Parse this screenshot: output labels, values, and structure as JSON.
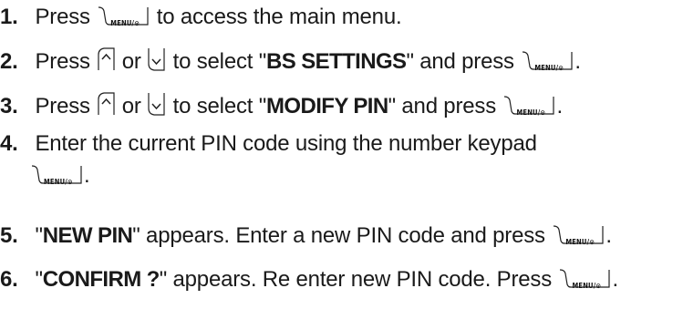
{
  "steps": [
    {
      "number": "1.",
      "text_a": " Press ",
      "text_b": " to access the main menu."
    },
    {
      "number": "2.",
      "text_a": " Press ",
      "text_or": " or ",
      "text_b": " to select \"",
      "keyword": "BS SETTINGS",
      "text_c": "\" and press ",
      "text_end": "."
    },
    {
      "number": "3.",
      "text_a": " Press ",
      "text_or": " or ",
      "text_b": " to select \"",
      "keyword": "MODIFY PIN",
      "text_c": "\" and press ",
      "text_end": "."
    },
    {
      "number": "4.",
      "text_a": " Enter the current PIN code using the number keypad",
      "text_end": "."
    },
    {
      "number": "5.",
      "text_a": " \"",
      "keyword": "NEW PIN",
      "text_b": "\" appears. Enter a new PIN code and press ",
      "text_end": "."
    },
    {
      "number": "6.",
      "text_a": " \"",
      "keyword": "CONFIRM ?",
      "text_b": "\" appears. Re enter new PIN code. Press ",
      "text_end": "."
    }
  ],
  "keys": {
    "menu_label": "MENU/⊙",
    "up_icon": "up-arrow-key-icon",
    "down_icon": "down-arrow-key-icon"
  }
}
